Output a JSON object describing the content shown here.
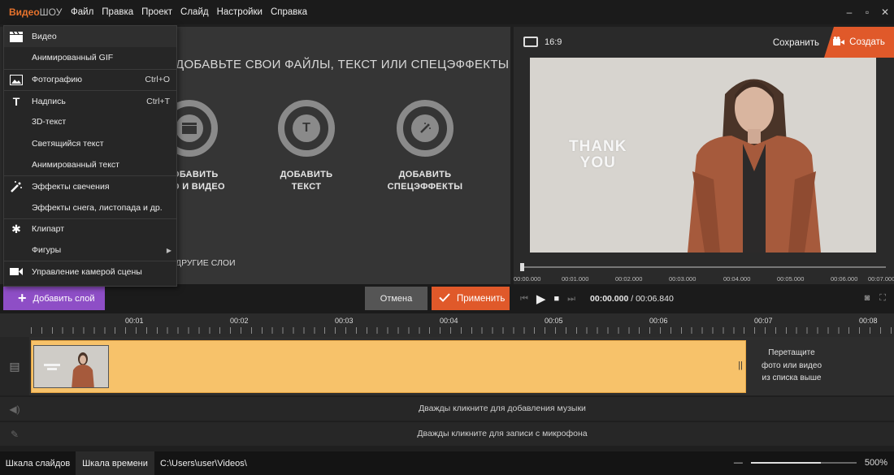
{
  "app": {
    "logo_a": "Видео",
    "logo_b": "ШОУ",
    "menu": [
      "Файл",
      "Правка",
      "Проект",
      "Слайд",
      "Настройки",
      "Справка"
    ],
    "win_controls": [
      "–",
      "▫",
      "✕"
    ]
  },
  "dropdown": {
    "items": [
      {
        "label": "Видео",
        "shortcut": "",
        "icon": "film-icon"
      },
      {
        "label": "Анимированный GIF",
        "shortcut": "",
        "icon": ""
      },
      {
        "label": "Фотографию",
        "shortcut": "Ctrl+O",
        "icon": "image-icon"
      },
      {
        "label": "Надпись",
        "shortcut": "Ctrl+T",
        "icon": "text-icon"
      },
      {
        "label": "3D-текст",
        "shortcut": "",
        "icon": ""
      },
      {
        "label": "Светящийся текст",
        "shortcut": "",
        "icon": ""
      },
      {
        "label": "Анимированный текст",
        "shortcut": "",
        "icon": ""
      },
      {
        "label": "Эффекты свечения",
        "shortcut": "",
        "icon": "magic-wand-icon"
      },
      {
        "label": "Эффекты снега, листопада и др.",
        "shortcut": "",
        "icon": ""
      },
      {
        "label": "Клипарт",
        "shortcut": "",
        "icon": "gear-icon"
      },
      {
        "label": "Фигуры",
        "shortcut": "",
        "icon": ""
      },
      {
        "label": "Управление камерой сцены",
        "shortcut": "",
        "icon": "camera-icon"
      }
    ]
  },
  "addpanel": {
    "headline": "ДОБАВЬТЕ СВОИ ФАЙЛЫ, ТЕКСТ ИЛИ СПЕЦЭФФЕКТЫ",
    "btn1_line1": "ОБАВИТЬ",
    "btn1_line2": "О И ВИДЕО",
    "btn2_line1": "ДОБАВИТЬ",
    "btn2_line2": "ТЕКСТ",
    "btn3_line1": "ДОБАВИТЬ",
    "btn3_line2": "СПЕЦЭФФЕКТЫ",
    "other_layers": "ДРУГИЕ СЛОИ"
  },
  "preview": {
    "ratio": "16:9",
    "save": "Сохранить",
    "create": "Создать",
    "thank_line1": "THANK",
    "thank_line2": "YOU",
    "ruler_labels": [
      "00:00.000",
      "00:01.000",
      "00:02.000",
      "00:03.000",
      "00:04.000",
      "00:05.000",
      "00:06.000",
      "00:07.000"
    ]
  },
  "actions": {
    "add_layer": "Добавить слой",
    "cancel": "Отмена",
    "apply": "Применить",
    "time_current": "00:00.000",
    "time_sep": " / ",
    "time_total": "00:06.840"
  },
  "timeline": {
    "labels": [
      "00:01",
      "00:02",
      "00:03",
      "00:04",
      "00:05",
      "00:06",
      "00:07",
      "00:08"
    ],
    "drop_line1": "Перетащите",
    "drop_line2": "фото или видео",
    "drop_line3": "из списка выше",
    "music_hint": "Дважды кликните для добавления музыки",
    "mic_hint": "Дважды кликните для записи с микрофона"
  },
  "bottom": {
    "tab_slides": "Шкала слайдов",
    "tab_timeline": "Шкала времени",
    "path": "C:\\Users\\user\\Videos\\",
    "zoom": "500%",
    "zoom_level": 0.66
  },
  "colors": {
    "accent_orange": "#e0592a",
    "accent_purple": "#8e4ec6",
    "clip_yellow": "#f7c26a"
  }
}
